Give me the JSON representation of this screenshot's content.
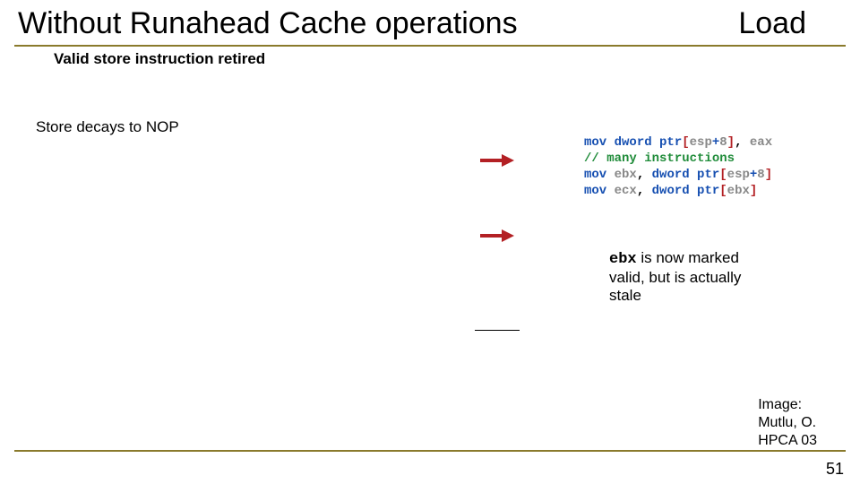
{
  "title_left": "Without Runahead Cache operations",
  "title_right": "Load",
  "sub1": "Valid store instruction retired",
  "sub2": "Store decays to NOP",
  "code": {
    "l1": {
      "kw1": "mov",
      "kw2": " dword ptr",
      "br1": "[",
      "reg1": "esp",
      "op1": "+",
      "num1": "8",
      "br2": "]",
      "sep": ", ",
      "reg2": "eax"
    },
    "l2": {
      "cmt": "// many instructions"
    },
    "l3": {
      "kw1": "mov",
      "reg1": " ebx",
      "sep": ", ",
      "kw2": "dword ptr",
      "br1": "[",
      "reg2": "esp",
      "op1": "+",
      "num1": "8",
      "br2": "]"
    },
    "l4": {
      "kw1": "mov",
      "reg1": " ecx",
      "sep": ", ",
      "kw2": "dword ptr",
      "br1": "[",
      "reg2": "ebx",
      "br2": "]"
    }
  },
  "note": {
    "reg": "ebx",
    "text1": " is now marked",
    "text2": "valid, but is actually",
    "text3": "stale"
  },
  "credit": {
    "l1": "Image:",
    "l2": "Mutlu, O.",
    "l3": "HPCA 03"
  },
  "page": "51"
}
